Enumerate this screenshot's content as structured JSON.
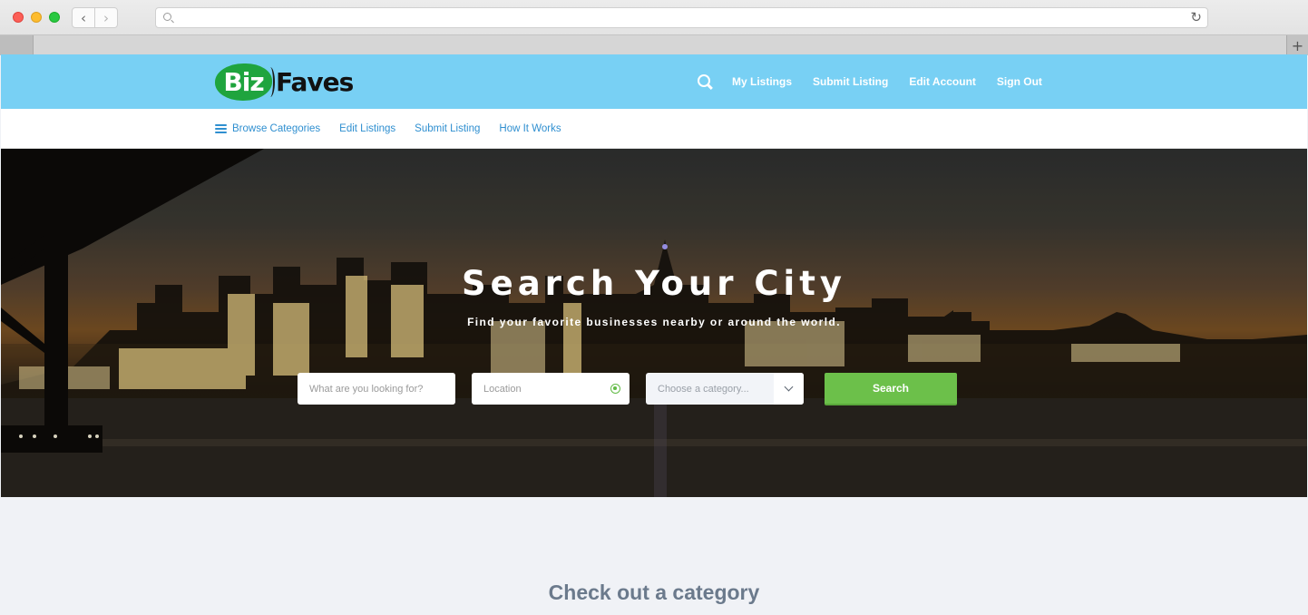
{
  "browser": {
    "url": "",
    "back_glyph": "‹",
    "forward_glyph": "›",
    "reload_glyph": "↻",
    "new_tab_glyph": "+"
  },
  "header": {
    "logo": {
      "part1": "Biz",
      "part2": "Faves"
    },
    "nav": [
      {
        "label": "My Listings"
      },
      {
        "label": "Submit Listing"
      },
      {
        "label": "Edit Account"
      },
      {
        "label": "Sign Out"
      }
    ],
    "colors": {
      "header_bg": "#78d0f4",
      "logo_green": "#1fa43e"
    }
  },
  "subnav": {
    "items": [
      {
        "label": "Browse Categories"
      },
      {
        "label": "Edit Listings"
      },
      {
        "label": "Submit Listing"
      },
      {
        "label": "How It Works"
      }
    ],
    "link_color": "#2f8fd0"
  },
  "hero": {
    "title": "Search Your City",
    "subtitle": "Find your favorite businesses nearby or around the world.",
    "search": {
      "what_placeholder": "What are you looking for?",
      "what_value": "",
      "location_placeholder": "Location",
      "location_value": "",
      "category_selected": "Choose a category...",
      "button_label": "Search",
      "button_color": "#6cc04a"
    }
  },
  "main": {
    "section_title": "Check out a category"
  }
}
